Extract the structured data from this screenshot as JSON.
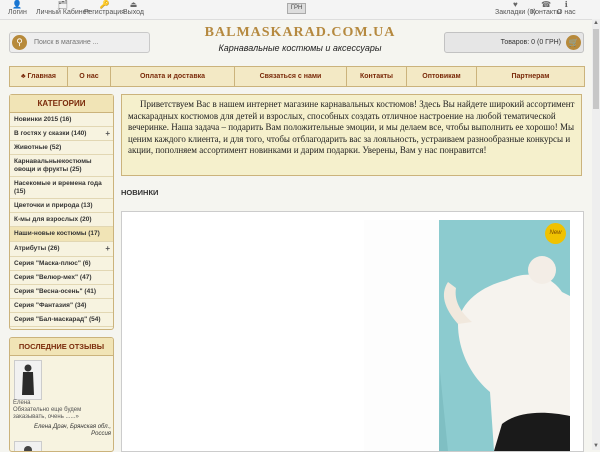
{
  "topbar": {
    "left": [
      {
        "label": "Логин",
        "icon": "user-icon",
        "glyph": "👤"
      },
      {
        "label": "Личный Кабинет",
        "icon": "user-card-icon",
        "glyph": "🗂"
      },
      {
        "label": "Регистрация",
        "icon": "key-icon",
        "glyph": "🔑"
      },
      {
        "label": "Выход",
        "icon": "exit-icon",
        "glyph": "⏏"
      }
    ],
    "currency": "ГРН",
    "right": [
      {
        "label": "Закладки (0)",
        "icon": "heart-icon",
        "glyph": "♥"
      },
      {
        "label": "Контакты",
        "icon": "phone-icon",
        "glyph": "☎"
      },
      {
        "label": "О нас",
        "icon": "info-icon",
        "glyph": "ℹ"
      }
    ]
  },
  "header": {
    "search_placeholder": "Поиск в магазине ...",
    "logo": "BALMASKARAD.COM.UA",
    "tagline": "Карнавальные костюмы и аксессуары",
    "cart_label": "Товаров: 0 (0 ГРН)"
  },
  "nav": [
    "♣ Главная",
    "О нас",
    "Оплата и доставка",
    "Связаться с нами",
    "Контакты",
    "Оптовикам",
    "Партнерам"
  ],
  "sidebar": {
    "title": "КАТЕГОРИИ",
    "items": [
      {
        "label": "Новинки 2015 (16)",
        "plus": false
      },
      {
        "label": "В гостях у сказки (140)",
        "plus": true
      },
      {
        "label": "Животные (52)",
        "plus": false
      },
      {
        "label": "Карнавальныекостюмы овощи и фрукты (25)",
        "plus": false
      },
      {
        "label": "Насекомые и времена года (15)",
        "plus": false
      },
      {
        "label": "Цветочки и природа (13)",
        "plus": false
      },
      {
        "label": "К-мы для взрослых (20)",
        "plus": false
      },
      {
        "label": "Наши-новые костюмы (17)",
        "plus": false
      },
      {
        "label": "Атрибуты (26)",
        "plus": true
      },
      {
        "label": "Серия \"Маска-плюс\" (6)",
        "plus": false
      },
      {
        "label": "Серия \"Велюр-мех\" (47)",
        "plus": false
      },
      {
        "label": "Серия \"Весна-осень\" (41)",
        "plus": false
      },
      {
        "label": "Серия \"Фантазия\" (34)",
        "plus": false
      },
      {
        "label": "Серия \"Бал-маскарад\" (54)",
        "plus": false
      }
    ]
  },
  "reviews": {
    "title": "ПОСЛЕДНИЕ ОТЗЫВЫ",
    "name": "Елена",
    "text": "Обязательно еще будем заказывать, очень ......»",
    "author": "Елена Драч, Брянская обл., Россия"
  },
  "intro": "Приветствуем Вас в нашем интернет магазине карнавальных костюмов! Здесь Вы найдете широкий ассортимент маскарадных костюмов для детей и взрослых, способных создать отличное настроение на любой тематической вечеринке. Наша задача – подарить Вам положительные эмоции, и мы делаем все, чтобы выполнить ее хорошо! Мы ценим каждого клиента, и для того, чтобы отблагодарить вас за лояльность, устраиваем разнообразные конкурсы и акции, пополняем ассортимент новинками и дарим подарки. Уверены, Вам у нас понравится!",
  "section_title": "НОВИНКИ",
  "product": {
    "badge": "New"
  },
  "colors": {
    "accent": "#b78a3b",
    "nav_text": "#7a2a0a",
    "nav_bg": "#f3e9c5",
    "border": "#cbb37c",
    "intro_bg": "#f5f0cc"
  }
}
